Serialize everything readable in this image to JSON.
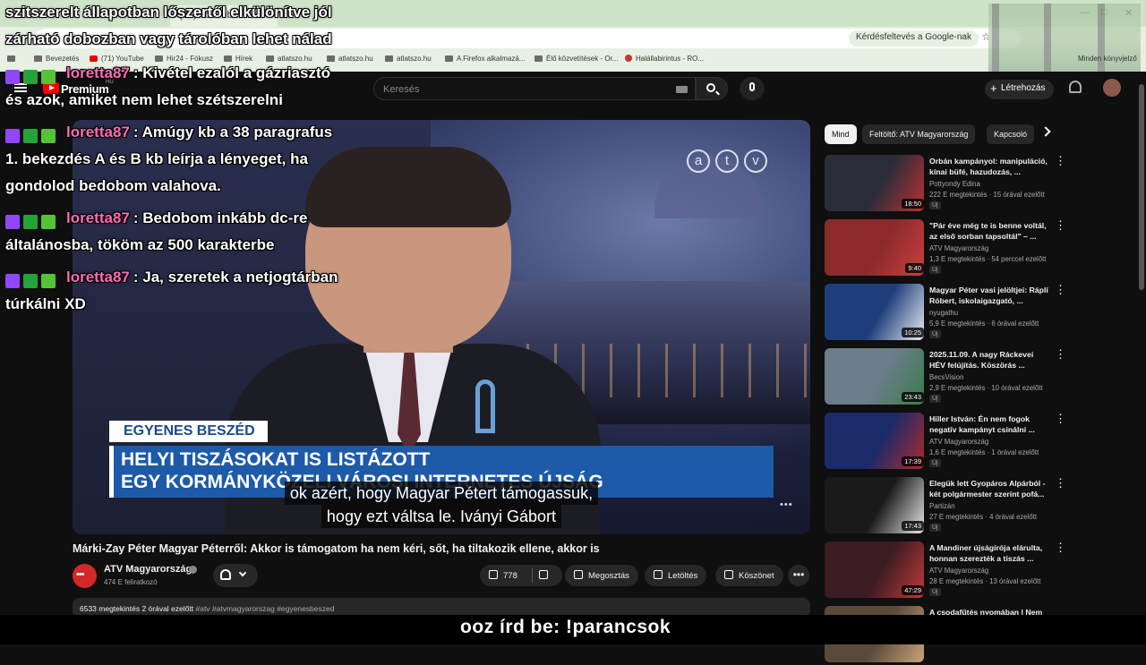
{
  "browser": {
    "tab_label": "(71) YouTube",
    "google_chip": "Kérdésfeltevés a Google-nak",
    "bookmarks": [
      "Bevezetés",
      "(71) YouTube",
      "Hir24 - Fókusz",
      "Hírek",
      "atlatszo.hu",
      "atlatszo.hu",
      "atlatszo.hu",
      "A Firefox alkalmazá...",
      "Élő közvetítések - Or...",
      "Halállabirintus - RO..."
    ],
    "bookmarks_right": "Minden könyvjelző"
  },
  "youtube": {
    "brand": "Premium",
    "region": "HU",
    "search_placeholder": "Keresés",
    "create_label": "Létrehozás"
  },
  "player": {
    "channel_logo": [
      "a",
      "t",
      "v"
    ],
    "lower_third_tag": "EGYENES BESZÉD",
    "lower_third_line1": "HELYI TISZÁSOKAT IS LISTÁZOTT",
    "lower_third_line2": "EGY KORMÁNYKÖZELI VÁROSI INTERNETES ÚJSÁG",
    "caption_line1": "ok azért, hogy Magyar Pétert támogassuk,",
    "caption_line2": "hogy ezt váltsa le. Iványi Gábort",
    "watermark": "•••"
  },
  "video": {
    "title": "Márki-Zay Péter Magyar Péterről: Akkor is támogatom ha nem kéri, sőt, ha tiltakozik ellene, akkor is",
    "channel": "ATV Magyarország",
    "subscribers": "474 E feliratkozó",
    "likes": "778",
    "share": "Megosztás",
    "download": "Letöltés",
    "thanks": "Köszönet",
    "more": "•••",
    "views_time": "6533 megtekintés  2 órával ezelőtt",
    "hashtags": "#atv #atvmagyarorszag #egyenesbeszed"
  },
  "sidebar": {
    "chips": [
      "Mind",
      "Feltöltő: ATV Magyarország",
      "Kapcsoló"
    ],
    "recs": [
      {
        "title": "Orbán kampányol: manipuláció, kínai büfé, hazudozás, ...",
        "channel": "Pottyondy Edina",
        "meta": "222 E megtekintés · 15 órával ezelőtt",
        "badge": "Új",
        "duration": "18:50",
        "color1": "#2a2c3a",
        "color2": "#b33"
      },
      {
        "title": "\"Pár éve még te is benne voltál, az első sorban tapsoltál\" – ...",
        "channel": "ATV Magyarország",
        "meta": "1,3 E megtekintés · 54 perccel ezelőtt",
        "badge": "Új",
        "duration": "9:40",
        "color1": "#8c2a2a",
        "color2": "#c94040"
      },
      {
        "title": "Magyar Péter vasi jelöltjei: Ráplí Róbert, iskolaigazgató, ...",
        "channel": "nyugathu",
        "meta": "5,9 E megtekintés · 6 órával ezelőtt",
        "badge": "Új",
        "duration": "10:25",
        "color1": "#1e3d7a",
        "color2": "#e9edf5"
      },
      {
        "title": "2025.11.09. A nagy Ráckevei HÉV felújítás. Köszörás ...",
        "channel": "BecsVision",
        "meta": "2,9 E megtekintés · 10 órával ezelőtt",
        "badge": "Új",
        "duration": "23:43",
        "color1": "#6a7d8a",
        "color2": "#3b7a4a"
      },
      {
        "title": "Hiller István: Én nem fogok negatív kampányt csinálni ...",
        "channel": "ATV Magyarország",
        "meta": "1,6 E megtekintés · 1 órával ezelőtt",
        "badge": "Új",
        "duration": "17:39",
        "color1": "#1a2a6a",
        "color2": "#b02a2a"
      },
      {
        "title": "Elegük lett Gyopáros Alpárból - két polgármester szerint pofá...",
        "channel": "Partizán",
        "meta": "27 E megtekintés · 4 órával ezelőtt",
        "badge": "Új",
        "duration": "17:43",
        "color1": "#1a1a1a",
        "color2": "#e8e8e8"
      },
      {
        "title": "A Mandiner újságírója elárulta, honnan szerezték a tiszás ...",
        "channel": "ATV Magyarország",
        "meta": "28 E megtekintés · 13 órával ezelőtt",
        "badge": "Új",
        "duration": "47:29",
        "color1": "#3a1c22",
        "color2": "#c23a3a"
      },
      {
        "title": "A csodafűtés nyomában | Nem",
        "channel": "",
        "meta": "",
        "badge": "",
        "duration": "",
        "color1": "#5a4a3a",
        "color2": "#c9a37a"
      }
    ]
  },
  "chat": [
    {
      "user": "",
      "lines": [
        "szitszerelt állapotban lőszertől elkülönítve jól",
        "zárható dobozban vagy tárolóban lehet nálad"
      ],
      "badges": false
    },
    {
      "user": "loretta87",
      "lines": [
        ": Kivétel ezalól a gázriasztó",
        "és azok, amiket nem lehet szétszerelni"
      ],
      "badges": true
    },
    {
      "user": "loretta87",
      "lines": [
        ": Amúgy kb a 38 paragrafus",
        "1. bekezdés A és B kb leírja a lényeget, ha",
        "gondolod bedobom valahova."
      ],
      "badges": true
    },
    {
      "user": "loretta87",
      "lines": [
        ": Bedobom inkább dc-re",
        "általánosba, tököm az 500 karakterbe"
      ],
      "badges": true
    },
    {
      "user": "loretta87",
      "lines": [
        ": Ja, szeretek a netjogtárban",
        "túrkálni XD"
      ],
      "badges": true
    }
  ],
  "bottom_banner": "ooz írd be: !parancsok"
}
